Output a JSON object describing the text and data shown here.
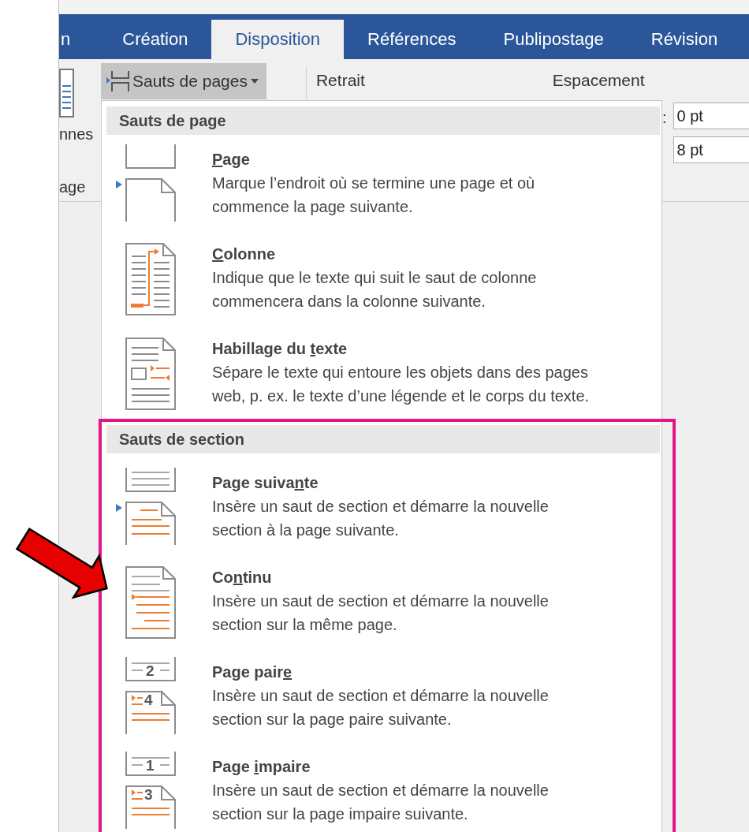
{
  "ribbon_tabs": [
    {
      "label": "n",
      "selected": false
    },
    {
      "label": "Création",
      "selected": false
    },
    {
      "label": "Disposition",
      "selected": true
    },
    {
      "label": "Références",
      "selected": false
    },
    {
      "label": "Publipostage",
      "selected": false
    },
    {
      "label": "Révision",
      "selected": false
    }
  ],
  "ribbon": {
    "left_fragments": [
      "nnes",
      "age"
    ],
    "breaks_button": {
      "label": "Sauts de pages",
      "open": true
    },
    "indent_label": "Retrait",
    "spacing_label": "Espacement",
    "spacing_colon": ":",
    "spacing_fields": [
      {
        "value": "0 pt"
      },
      {
        "value": "8 pt"
      }
    ]
  },
  "menu": {
    "sections": [
      {
        "title": "Sauts de page",
        "highlighted": false,
        "items": [
          {
            "kind": "page",
            "title": {
              "key": "P",
              "after": "age"
            },
            "description": [
              "Marque l’endroit où se termine une page et où",
              "commence la page suivante."
            ],
            "callout": false
          },
          {
            "kind": "column",
            "title": {
              "key": "C",
              "after": "olonne"
            },
            "description": [
              "Indique que le texte qui suit le saut de colonne",
              "commencera dans la colonne suivante."
            ],
            "callout": false
          },
          {
            "kind": "wrap",
            "title": {
              "before": "Habillage du ",
              "key": "t",
              "after": "exte"
            },
            "description": [
              "Sépare le texte qui entoure les objets dans des pages",
              "web, p. ex. le texte d’une légende et le corps du texte."
            ],
            "callout": false
          }
        ]
      },
      {
        "title": "Sauts de section",
        "highlighted": true,
        "items": [
          {
            "kind": "next",
            "title": {
              "before": "Page suiva",
              "key": "n",
              "after": "te"
            },
            "description": [
              "Insère un saut de section et démarre la nouvelle",
              "section à la page suivante."
            ],
            "callout": false
          },
          {
            "kind": "continuous",
            "title": {
              "before": "Co",
              "key": "n",
              "after": "tinu"
            },
            "description": [
              "Insère un saut de section et démarre la nouvelle",
              "section sur la même page."
            ],
            "callout": true
          },
          {
            "kind": "even",
            "title": {
              "before": "Page pair",
              "key": "e"
            },
            "icon_numbers": [
              "2",
              "4"
            ],
            "description": [
              "Insère un saut de section et démarre la nouvelle",
              "section sur la page paire suivante."
            ],
            "callout": false
          },
          {
            "kind": "odd",
            "title": {
              "before": "Page ",
              "key": "i",
              "after": "mpaire"
            },
            "icon_numbers": [
              "1",
              "3"
            ],
            "description": [
              "Insère un saut de section et démarre la nouvelle",
              "section sur la page impaire suivante."
            ],
            "callout": false
          }
        ]
      }
    ]
  }
}
